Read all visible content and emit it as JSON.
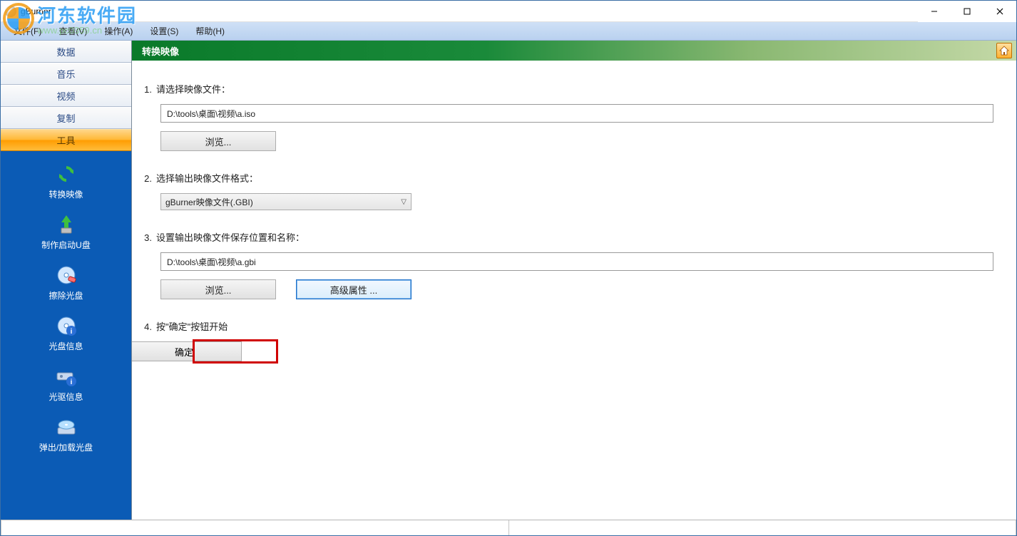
{
  "window": {
    "title": "gBurner"
  },
  "menu": {
    "file": "文件(F)",
    "view": "查看(V)",
    "action": "操作(A)",
    "settings": "设置(S)",
    "help": "帮助(H)"
  },
  "watermark": {
    "cn": "河东软件园",
    "url": "www.pc0359.cn"
  },
  "sidebar": {
    "cats": {
      "data": "数据",
      "music": "音乐",
      "video": "视频",
      "copy": "复制",
      "tools": "工具"
    },
    "tools": {
      "convert": "转换映像",
      "bootusb": "制作启动U盘",
      "erase": "擦除光盘",
      "discinfo": "光盘信息",
      "driveinfo": "光驱信息",
      "eject": "弹出/加载光盘"
    }
  },
  "page": {
    "title": "转换映像",
    "step1": {
      "num": "1.",
      "label": "请选择映像文件：",
      "value": "D:\\tools\\桌面\\视频\\a.iso",
      "browse": "浏览..."
    },
    "step2": {
      "num": "2.",
      "label": "选择输出映像文件格式：",
      "value": "gBurner映像文件(.GBI)"
    },
    "step3": {
      "num": "3.",
      "label": "设置输出映像文件保存位置和名称：",
      "value": "D:\\tools\\桌面\\视频\\a.gbi",
      "browse": "浏览...",
      "advanced": "高级属性 ..."
    },
    "step4": {
      "num": "4.",
      "label": "按\"确定\"按钮开始",
      "ok": "确定"
    }
  }
}
